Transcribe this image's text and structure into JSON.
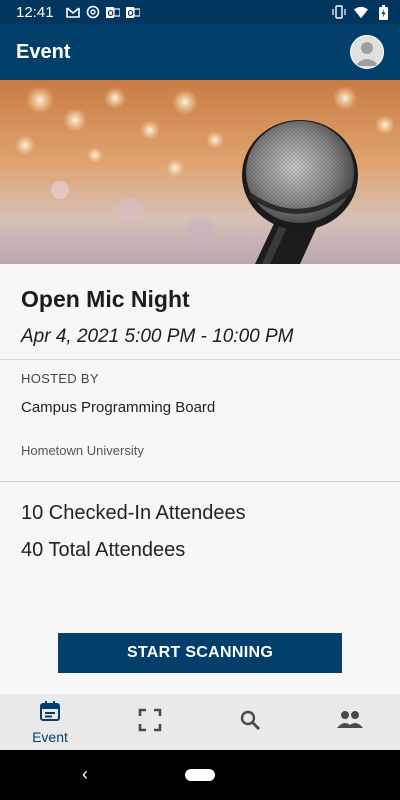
{
  "status_bar": {
    "time": "12:41",
    "left_icons": [
      "gmail-icon",
      "at-sign-icon",
      "outlook-icon",
      "outlook-icon"
    ],
    "right_icons": [
      "vibrate-icon",
      "wifi-icon",
      "battery-icon"
    ]
  },
  "app_bar": {
    "title": "Event",
    "avatar_icon": "account-avatar-icon"
  },
  "hero": {
    "image": "microphone-photo"
  },
  "event": {
    "title": "Open Mic Night",
    "date": "Apr 4, 2021 5:00 PM - 10:00 PM",
    "hosted_label": "HOSTED BY",
    "host_name": "Campus Programming Board",
    "host_org": "Hometown University",
    "checked_in": "10 Checked-In Attendees",
    "total": "40 Total Attendees"
  },
  "actions": {
    "scan_label": "START SCANNING"
  },
  "bottom_nav": {
    "items": [
      {
        "label": "Event",
        "icon": "calendar-icon",
        "active": true
      },
      {
        "label": "",
        "icon": "scan-frame-icon",
        "active": false
      },
      {
        "label": "",
        "icon": "search-icon",
        "active": false
      },
      {
        "label": "",
        "icon": "people-icon",
        "active": false
      }
    ]
  },
  "colors": {
    "primary": "#033f6b",
    "status_bar": "#02365f",
    "nav_background": "#e9e9e9",
    "inactive_icon": "#4a4a4a"
  }
}
